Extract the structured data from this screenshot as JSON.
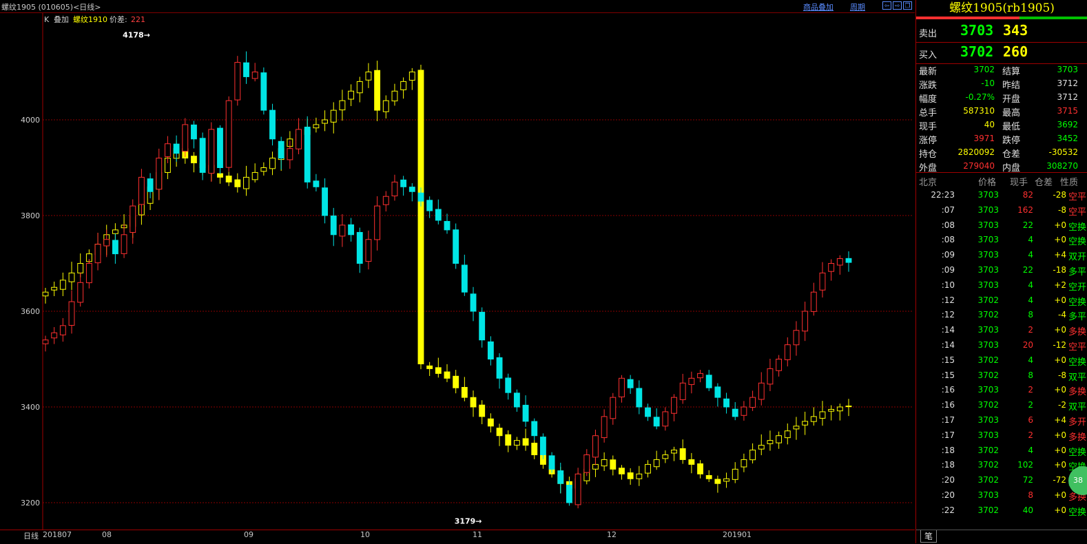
{
  "header": {
    "title": "螺纹1905 (010605)<日线>",
    "overlay_link": "商品叠加",
    "period_link": "周期"
  },
  "legend": {
    "k": "K",
    "overlay": "叠加",
    "compare": "螺纹1910",
    "spread_label": "价差:",
    "spread_value": "221"
  },
  "colors": {
    "up": "#ff3030",
    "down": "#00e5e5",
    "overlay": "#ffff00",
    "grid": "#8b0000"
  },
  "chart_data": {
    "type": "candlestick",
    "ylim": [
      3150,
      4200
    ],
    "yticks": [
      3200,
      3400,
      3600,
      3800,
      4000
    ],
    "xlabels": [
      "日线",
      "201807",
      "08",
      "09",
      "10",
      "11",
      "12",
      "201901"
    ],
    "annotations": [
      {
        "text": "4178",
        "value": 4178,
        "index": 12
      },
      {
        "text": "3179",
        "value": 3179,
        "index": 50
      }
    ],
    "main_close": [
      3540,
      3555,
      3570,
      3620,
      3660,
      3700,
      3740,
      3750,
      3720,
      3760,
      3820,
      3880,
      3850,
      3920,
      3950,
      3930,
      3990,
      3960,
      3890,
      3980,
      3900,
      4040,
      4120,
      4090,
      4100,
      4020,
      3960,
      3920,
      3940,
      3980,
      3870,
      3860,
      3800,
      3760,
      3780,
      3760,
      3700,
      3750,
      3820,
      3840,
      3870,
      3860,
      3850,
      3830,
      3810,
      3790,
      3770,
      3700,
      3640,
      3600,
      3540,
      3500,
      3460,
      3430,
      3400,
      3370,
      3340,
      3300,
      3270,
      3240,
      3200,
      3260,
      3300,
      3340,
      3380,
      3420,
      3460,
      3440,
      3400,
      3380,
      3360,
      3390,
      3420,
      3450,
      3460,
      3470,
      3440,
      3420,
      3400,
      3380,
      3400,
      3420,
      3450,
      3480,
      3500,
      3530,
      3560,
      3600,
      3640,
      3680,
      3700,
      3710,
      3702
    ],
    "overlay_close": [
      3640,
      3650,
      3665,
      3680,
      3700,
      3720,
      3740,
      3760,
      3770,
      3780,
      3800,
      3830,
      3860,
      3890,
      3920,
      3940,
      3920,
      3910,
      3900,
      3890,
      3880,
      3870,
      3860,
      3880,
      3890,
      3900,
      3920,
      3940,
      3960,
      3970,
      3980,
      3990,
      4000,
      4020,
      4040,
      4060,
      4080,
      4100,
      4020,
      4040,
      4060,
      4080,
      4100,
      3490,
      3480,
      3470,
      3460,
      3440,
      3420,
      3400,
      3380,
      3360,
      3340,
      3320,
      3330,
      3320,
      3300,
      3280,
      3260,
      3240,
      3230,
      3250,
      3270,
      3280,
      3290,
      3270,
      3260,
      3250,
      3260,
      3280,
      3290,
      3300,
      3310,
      3290,
      3280,
      3260,
      3250,
      3240,
      3250,
      3270,
      3290,
      3310,
      3320,
      3330,
      3340,
      3350,
      3360,
      3370,
      3380,
      3390,
      3395,
      3400,
      3402
    ]
  },
  "quote": {
    "title": "螺纹1905(rb1905)",
    "ask_label": "卖出",
    "ask_price": "3703",
    "ask_vol": "343",
    "bid_label": "买入",
    "bid_price": "3702",
    "bid_vol": "260",
    "stats": [
      {
        "k": "最新",
        "v": "3702",
        "vc": "#00ff00",
        "k2": "结算",
        "v2": "3703",
        "v2c": "#00ff00"
      },
      {
        "k": "涨跌",
        "v": "-10",
        "vc": "#00ff00",
        "k2": "昨结",
        "v2": "3712",
        "v2c": "#e0e0e0"
      },
      {
        "k": "幅度",
        "v": "-0.27%",
        "vc": "#00ff00",
        "k2": "开盘",
        "v2": "3712",
        "v2c": "#e0e0e0"
      },
      {
        "k": "总手",
        "v": "587310",
        "vc": "#ffff00",
        "k2": "最高",
        "v2": "3715",
        "v2c": "#ff3030"
      },
      {
        "k": "现手",
        "v": "40",
        "vc": "#ffff00",
        "k2": "最低",
        "v2": "3692",
        "v2c": "#00ff00"
      },
      {
        "k": "涨停",
        "v": "3971",
        "vc": "#ff3030",
        "k2": "跌停",
        "v2": "3452",
        "v2c": "#00ff00"
      },
      {
        "k": "持仓",
        "v": "2820092",
        "vc": "#ffff00",
        "k2": "仓差",
        "v2": "-30532",
        "v2c": "#ffff00"
      },
      {
        "k": "外盘",
        "v": "279040",
        "vc": "#ff3030",
        "k2": "内盘",
        "v2": "308270",
        "v2c": "#00ff00"
      }
    ],
    "trade_headers": [
      "北京",
      "价格",
      "现手",
      "仓差",
      "性质"
    ],
    "trades": [
      {
        "t": "22:23",
        "p": "3703",
        "v": "82",
        "vc": "#ff3030",
        "d": "-28",
        "n": "空平",
        "nc": "#ff3030"
      },
      {
        "t": ":07",
        "p": "3703",
        "v": "162",
        "vc": "#ff3030",
        "d": "-8",
        "n": "空平",
        "nc": "#ff3030"
      },
      {
        "t": ":08",
        "p": "3703",
        "v": "22",
        "vc": "#00ff00",
        "d": "+0",
        "n": "空换",
        "nc": "#00ff00"
      },
      {
        "t": ":08",
        "p": "3703",
        "v": "4",
        "vc": "#00ff00",
        "d": "+0",
        "n": "空换",
        "nc": "#00ff00"
      },
      {
        "t": ":09",
        "p": "3703",
        "v": "4",
        "vc": "#00ff00",
        "d": "+4",
        "n": "双开",
        "nc": "#00ff00"
      },
      {
        "t": ":09",
        "p": "3703",
        "v": "22",
        "vc": "#00ff00",
        "d": "-18",
        "n": "多平",
        "nc": "#00ff00"
      },
      {
        "t": ":10",
        "p": "3703",
        "v": "4",
        "vc": "#00ff00",
        "d": "+2",
        "n": "空开",
        "nc": "#00ff00"
      },
      {
        "t": ":12",
        "p": "3702",
        "v": "4",
        "vc": "#00ff00",
        "d": "+0",
        "n": "空换",
        "nc": "#00ff00"
      },
      {
        "t": ":12",
        "p": "3702",
        "v": "8",
        "vc": "#00ff00",
        "d": "-4",
        "n": "多平",
        "nc": "#00ff00"
      },
      {
        "t": ":14",
        "p": "3703",
        "v": "2",
        "vc": "#ff3030",
        "d": "+0",
        "n": "多换",
        "nc": "#ff3030"
      },
      {
        "t": ":14",
        "p": "3703",
        "v": "20",
        "vc": "#ff3030",
        "d": "-12",
        "n": "空平",
        "nc": "#ff3030"
      },
      {
        "t": ":15",
        "p": "3702",
        "v": "4",
        "vc": "#00ff00",
        "d": "+0",
        "n": "空换",
        "nc": "#00ff00"
      },
      {
        "t": ":15",
        "p": "3702",
        "v": "8",
        "vc": "#00ff00",
        "d": "-8",
        "n": "双平",
        "nc": "#00ff00"
      },
      {
        "t": ":16",
        "p": "3703",
        "v": "2",
        "vc": "#ff3030",
        "d": "+0",
        "n": "多换",
        "nc": "#ff3030"
      },
      {
        "t": ":16",
        "p": "3702",
        "v": "2",
        "vc": "#00ff00",
        "d": "-2",
        "n": "双平",
        "nc": "#00ff00"
      },
      {
        "t": ":17",
        "p": "3703",
        "v": "6",
        "vc": "#ff3030",
        "d": "+4",
        "n": "多开",
        "nc": "#ff3030"
      },
      {
        "t": ":17",
        "p": "3703",
        "v": "2",
        "vc": "#ff3030",
        "d": "+0",
        "n": "多换",
        "nc": "#ff3030"
      },
      {
        "t": ":18",
        "p": "3702",
        "v": "4",
        "vc": "#00ff00",
        "d": "+0",
        "n": "空换",
        "nc": "#00ff00"
      },
      {
        "t": ":18",
        "p": "3702",
        "v": "102",
        "vc": "#00ff00",
        "d": "+0",
        "n": "空换",
        "nc": "#00ff00"
      },
      {
        "t": ":20",
        "p": "3702",
        "v": "72",
        "vc": "#00ff00",
        "d": "-72",
        "n": "双平",
        "nc": "#00ff00"
      },
      {
        "t": ":20",
        "p": "3703",
        "v": "8",
        "vc": "#ff3030",
        "d": "+0",
        "n": "多换",
        "nc": "#ff3030"
      },
      {
        "t": ":22",
        "p": "3702",
        "v": "40",
        "vc": "#00ff00",
        "d": "+0",
        "n": "空换",
        "nc": "#00ff00"
      }
    ],
    "tab": "笔",
    "badge": "38"
  }
}
